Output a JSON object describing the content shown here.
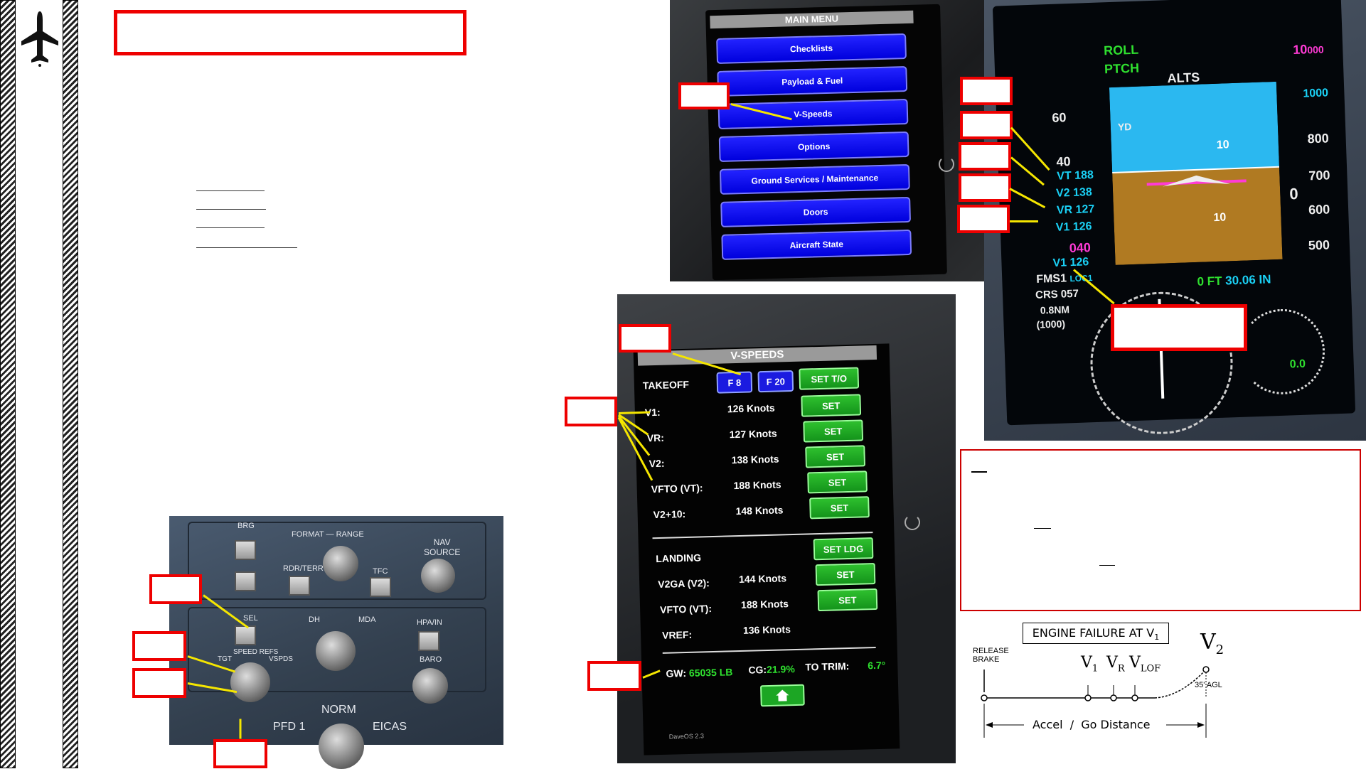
{
  "main_menu": {
    "title": "MAIN MENU",
    "items": [
      "Checklists",
      "Payload & Fuel",
      "V-Speeds",
      "Options",
      "Ground Services / Maintenance",
      "Doors",
      "Aircraft State"
    ]
  },
  "vspeeds": {
    "title": "V-SPEEDS",
    "takeoff_label": "TAKEOFF",
    "flap_buttons": [
      "F 8",
      "F 20"
    ],
    "set_to": "SET T/O",
    "takeoff_rows": [
      {
        "label": "V1:",
        "value": "126 Knots",
        "btn": "SET"
      },
      {
        "label": "VR:",
        "value": "127 Knots",
        "btn": "SET"
      },
      {
        "label": "V2:",
        "value": "138 Knots",
        "btn": "SET"
      },
      {
        "label": "VFTO (VT):",
        "value": "188 Knots",
        "btn": "SET"
      },
      {
        "label": "V2+10:",
        "value": "148 Knots",
        "btn": "SET"
      }
    ],
    "landing_label": "LANDING",
    "set_ldg": "SET LDG",
    "landing_rows": [
      {
        "label": "V2GA (V2):",
        "value": "144 Knots",
        "btn": "SET"
      },
      {
        "label": "VFTO (VT):",
        "value": "188 Knots",
        "btn": "SET"
      },
      {
        "label": "VREF:",
        "value": "136 Knots",
        "btn": ""
      }
    ],
    "gw_label": "GW:",
    "gw_value": "65035 LB",
    "cg_label": "CG:",
    "cg_value": "21.9%",
    "trim_label": "TO TRIM:",
    "trim_value": "6.7°",
    "version": "DaveOS 2.3"
  },
  "pfd": {
    "roll": "ROLL",
    "pitch": "PTCH",
    "alts": "ALTS",
    "alt_sel_big": "10",
    "alt_sel_small": "000",
    "vs_scale": [
      "1000",
      "800",
      "700",
      "600",
      "500"
    ],
    "speed_ticks": [
      "60",
      "40"
    ],
    "bugs": [
      "VT 188",
      "V2 138",
      "VR 127",
      "V1 126"
    ],
    "yd": "YD",
    "pitch_marks": [
      "10",
      "10"
    ],
    "hdg_bug": "040",
    "v1_readout": "V1 126",
    "fms": "FMS1",
    "loc": "LOC1",
    "crs": "CRS 057",
    "dist": "0.8NM",
    "dist2": "(1000)",
    "baro_ft": "0 FT",
    "baro_in": "30.06 IN",
    "vs_value": "0.0",
    "alt_zero": "0"
  },
  "panel": {
    "labels": [
      "BRG",
      "FORMAT",
      "RANGE",
      "NAV",
      "SOURCE",
      "RDR/TERR",
      "TFC",
      "SEL",
      "DH",
      "MDA",
      "HPA/IN",
      "SPEED REFS",
      "TGT",
      "VSPDS",
      "BARO",
      "NORM",
      "PFD 1",
      "EICAS"
    ]
  },
  "diagram": {
    "title": "ENGINE FAILURE AT V",
    "title_sub": "1",
    "v2": "V",
    "v2_sub": "2",
    "release": "RELEASE",
    "brake": "BRAKE",
    "v1": "V",
    "v1_sub": "1",
    "vr": "V",
    "vr_sub": "R",
    "vlof": "V",
    "vlof_sub": "LOF",
    "agl": "35' AGL",
    "distance": "Accel  /  Go Distance"
  },
  "colors": {
    "accent_red": "#e00000",
    "pfd_cyan": "#1ad0f5",
    "pfd_magenta": "#ff3bd5",
    "menu_blue": "#0000dd",
    "set_green": "#1ca624",
    "arrow_yellow": "#f5e600"
  }
}
